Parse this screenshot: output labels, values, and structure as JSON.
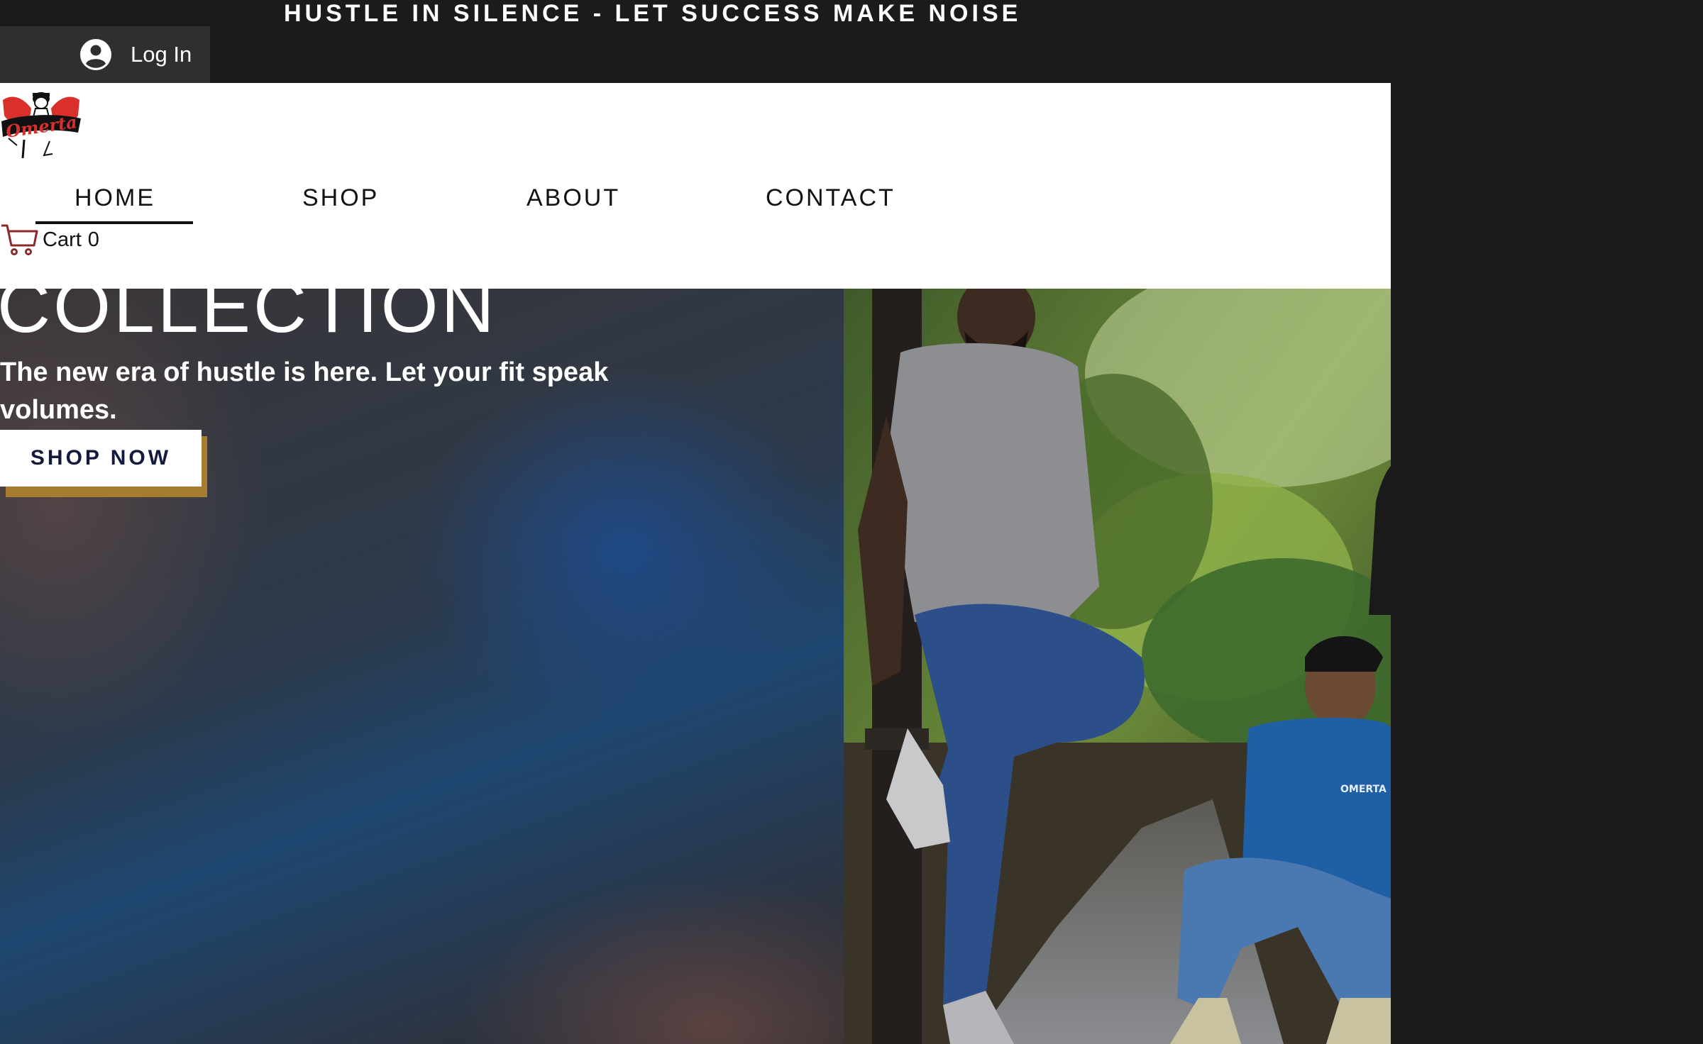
{
  "announcement": {
    "text": "HUSTLE IN SILENCE - LET SUCCESS MAKE NOISE"
  },
  "login": {
    "label": "Log In",
    "icon": "user-avatar-icon"
  },
  "brand": {
    "logo_text": "Omerta",
    "logo_accent": "#d9302c"
  },
  "nav": {
    "items": [
      {
        "label": "HOME",
        "active": true
      },
      {
        "label": "SHOP",
        "active": false
      },
      {
        "label": "ABOUT",
        "active": false
      },
      {
        "label": "CONTACT",
        "active": false
      }
    ]
  },
  "cart": {
    "label": "Cart",
    "count": "0",
    "icon": "cart-icon",
    "icon_color": "#8b2a2a"
  },
  "hero": {
    "title": "COLLECTION",
    "subtitle": "The new era of hustle is here. Let your fit speak volumes.",
    "cta": "SHOP NOW",
    "cta_shadow_color": "#a67c2e",
    "photo_shirt_text": "OMERTA"
  },
  "colors": {
    "dark": "#1b1b1b",
    "login_bg": "#2f2f2f",
    "header_bg": "#ffffff"
  }
}
